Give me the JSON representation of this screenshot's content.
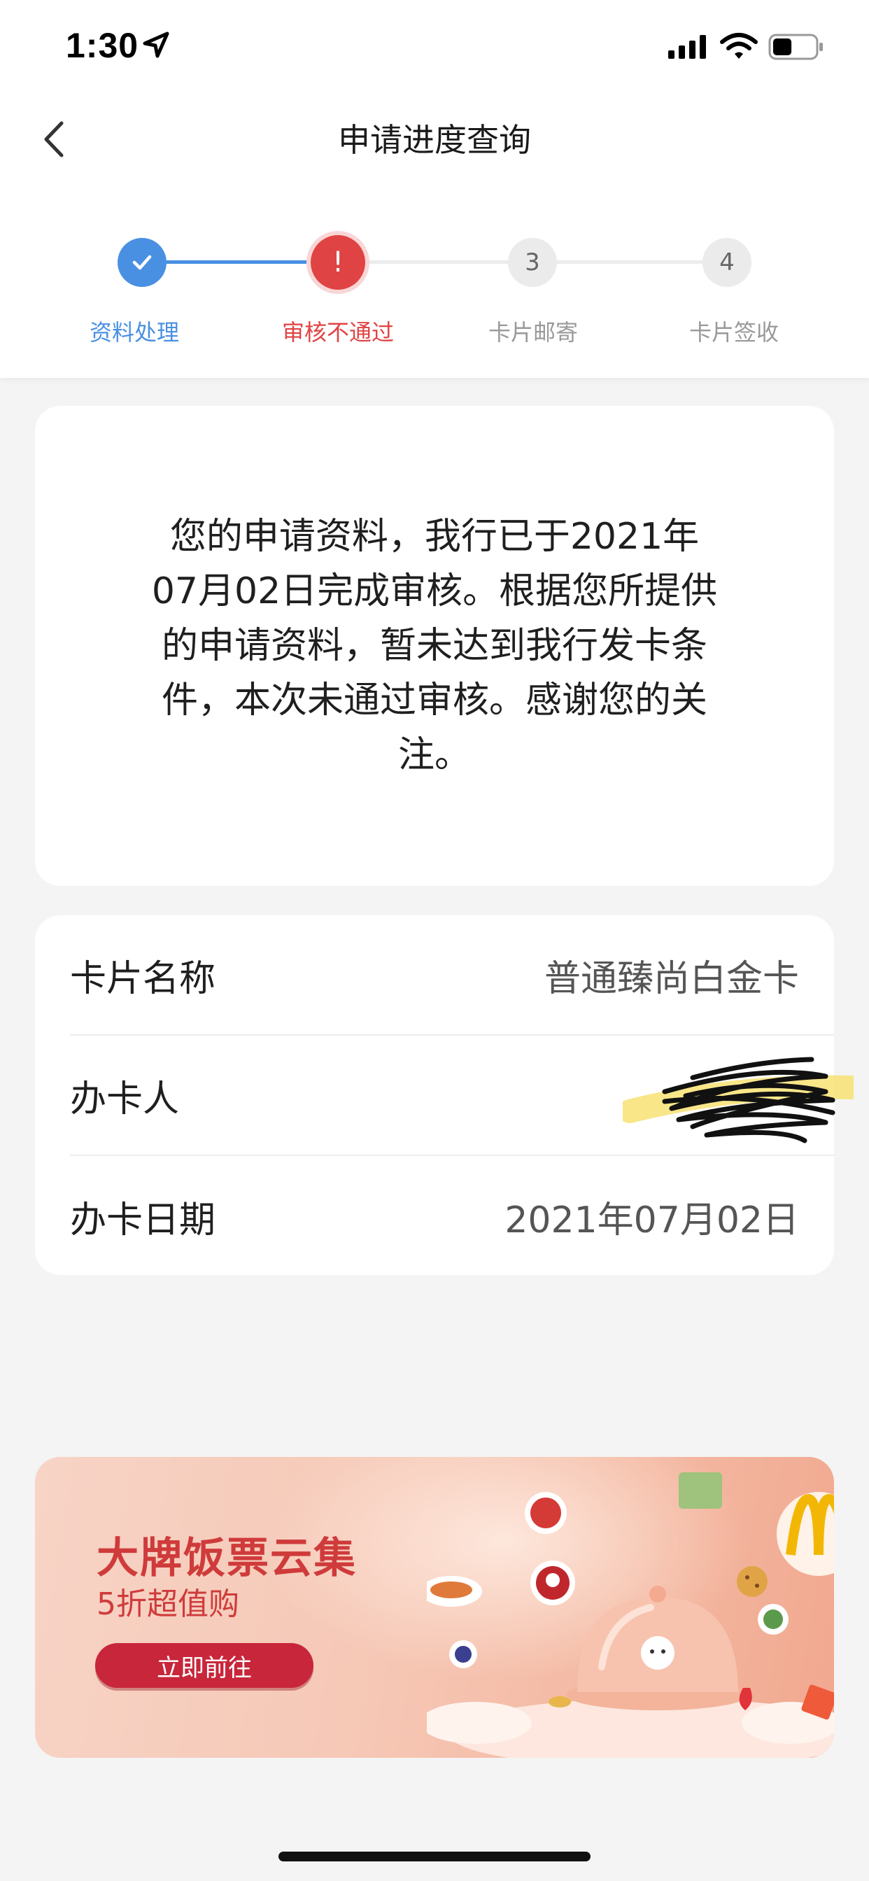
{
  "status_bar": {
    "time": "1:30",
    "battery_level": 0.45
  },
  "nav": {
    "title": "申请进度查询"
  },
  "steps": [
    {
      "label": "资料处理",
      "state": "done",
      "marker": "",
      "color": "#4a90e2"
    },
    {
      "label": "审核不通过",
      "state": "failed",
      "marker": "!",
      "color": "#e04343"
    },
    {
      "label": "卡片邮寄",
      "state": "pending",
      "marker": "3",
      "color": "#999999"
    },
    {
      "label": "卡片签收",
      "state": "pending",
      "marker": "4",
      "color": "#999999"
    }
  ],
  "message": {
    "text": "您的申请资料，我行已于2021年07月02日完成审核。根据您所提供的申请资料，暂未达到我行发卡条件，本次未通过审核。感谢您的关注。"
  },
  "info": {
    "rows": [
      {
        "label": "卡片名称",
        "value": "普通臻尚白金卡"
      },
      {
        "label": "办卡人",
        "value": ""
      },
      {
        "label": "办卡日期",
        "value": "2021年07月02日"
      }
    ]
  },
  "banner": {
    "title": "大牌饭票云集",
    "subtitle": "5折超值购",
    "button": "立即前往"
  },
  "colors": {
    "accent_blue": "#4a90e2",
    "error_red": "#e04343",
    "pending_grey": "#e8e8e8"
  }
}
